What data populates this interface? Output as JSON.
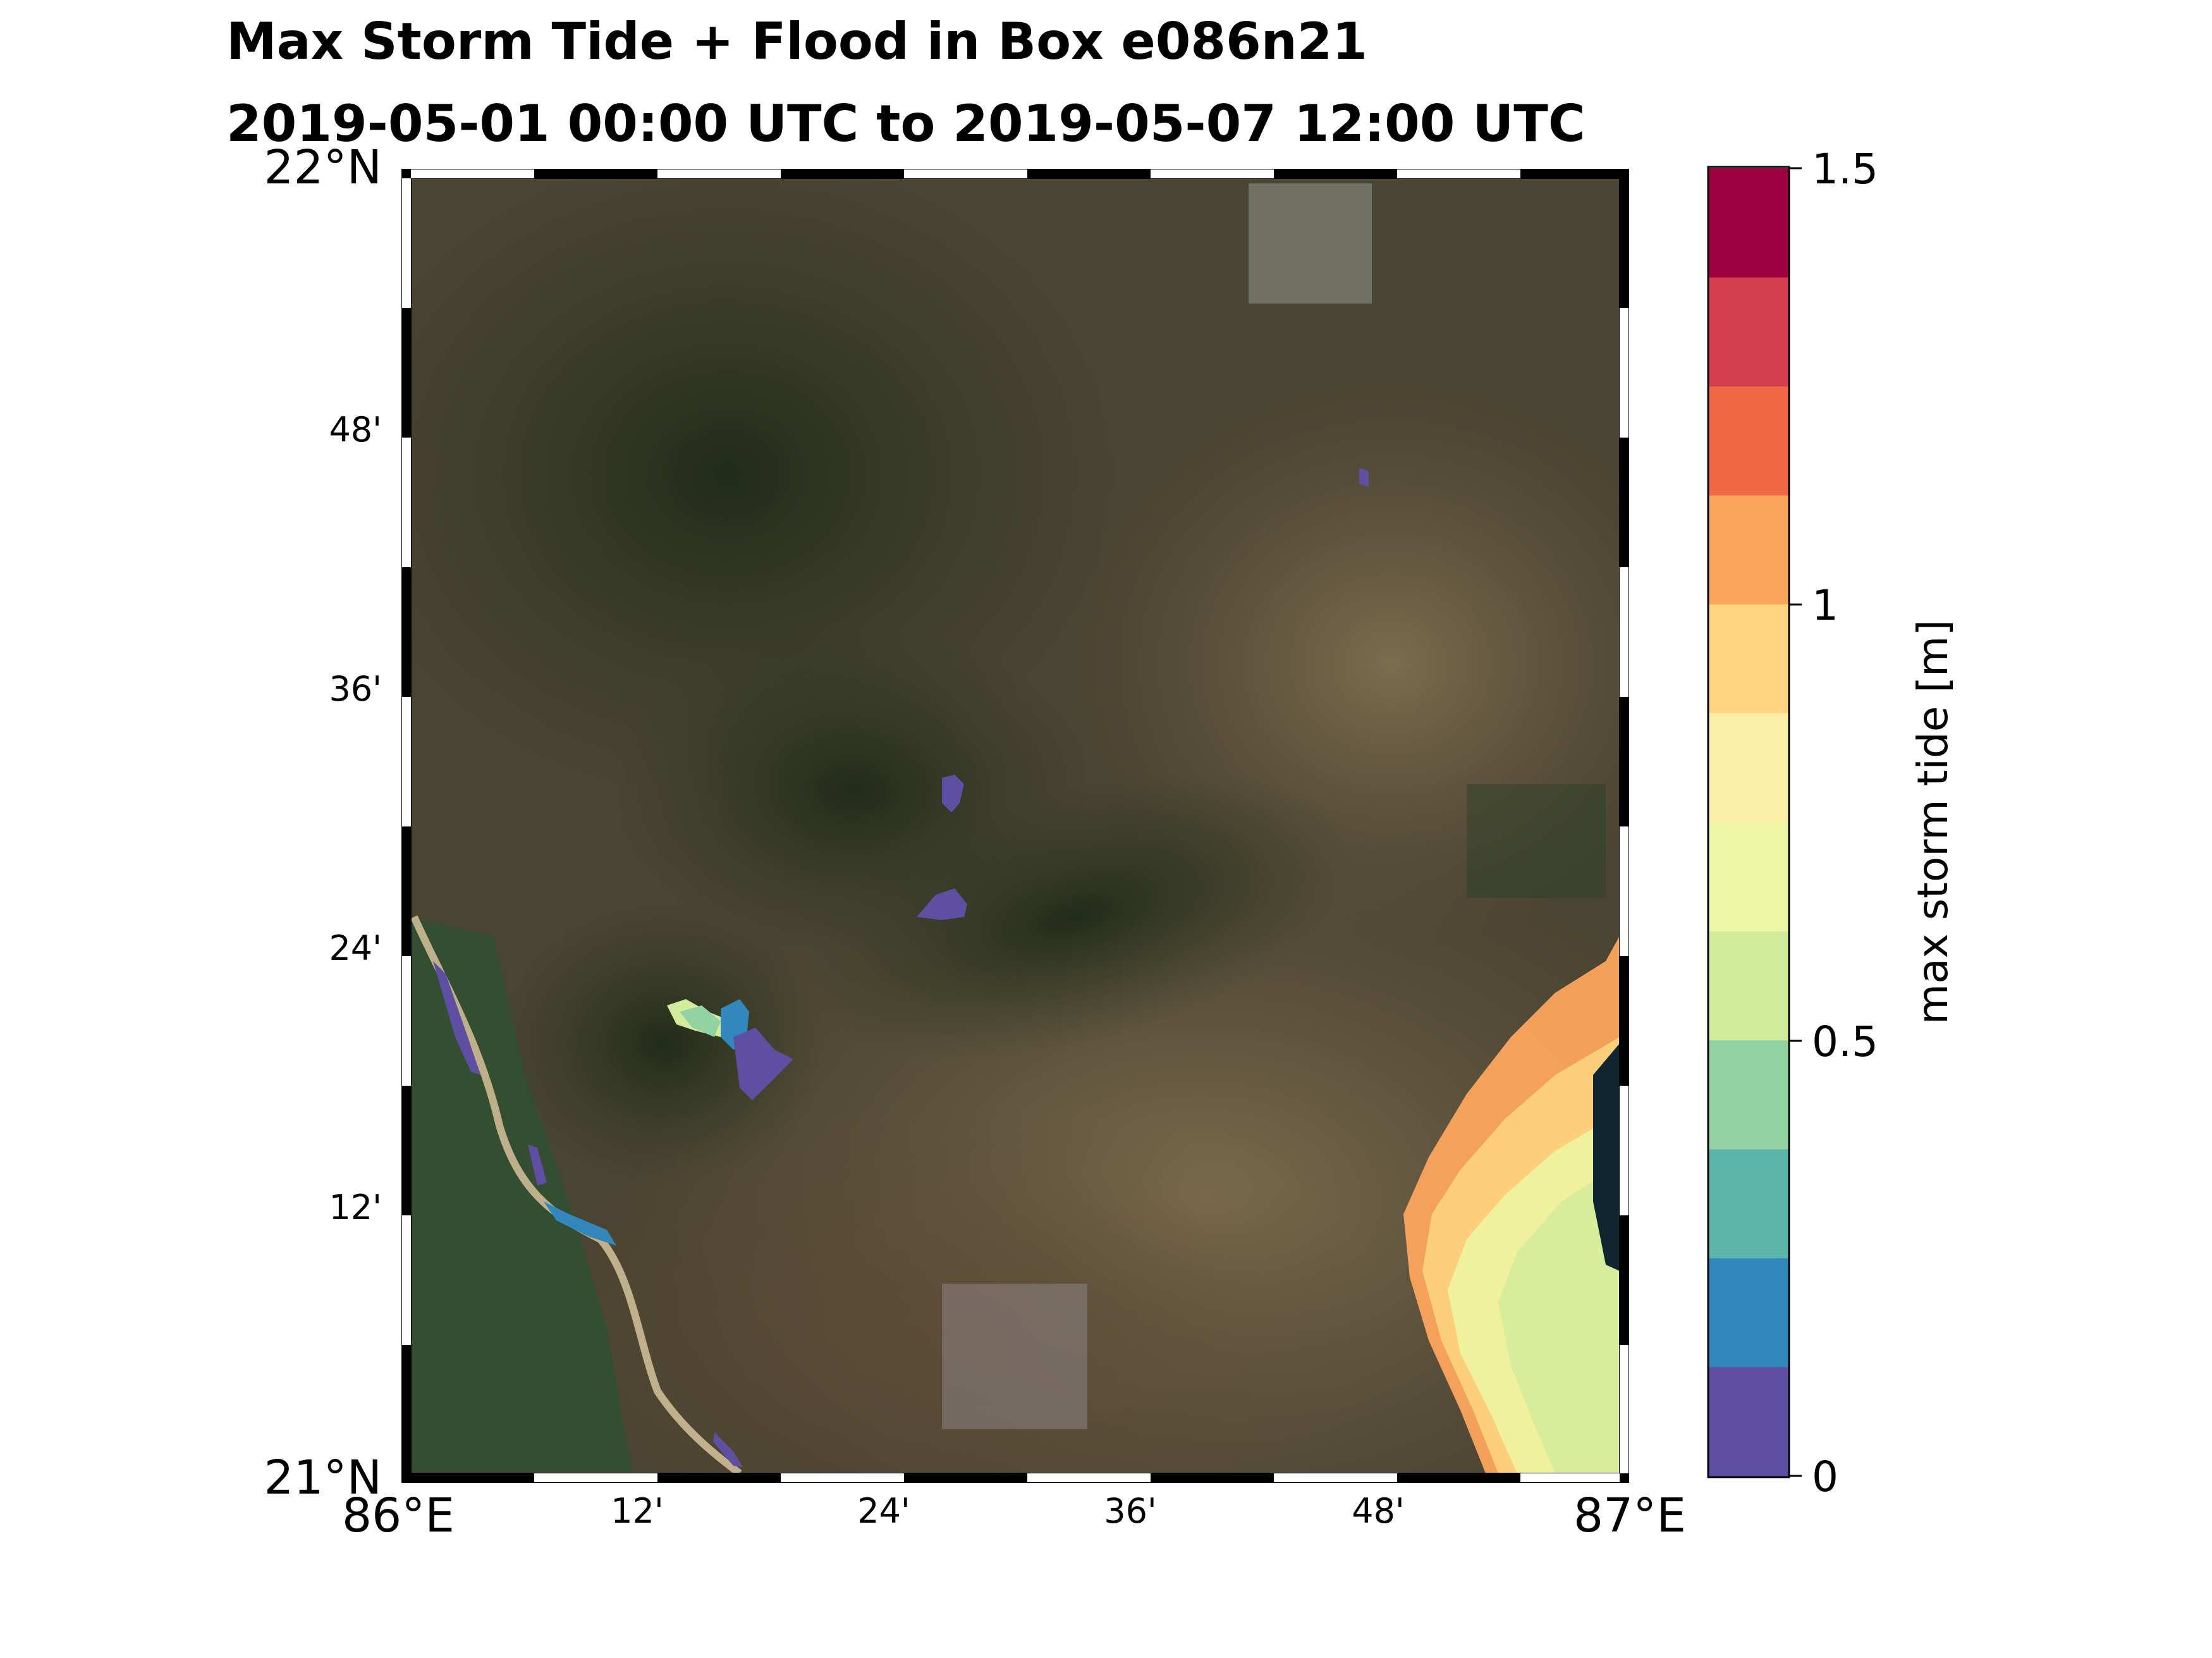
{
  "title": {
    "line1": "Max Storm Tide + Flood in Box e086n21",
    "line2": "2019-05-01 00:00 UTC to 2019-05-07 12:00 UTC"
  },
  "axes": {
    "lat_labels": [
      "22°N",
      "48'",
      "36'",
      "24'",
      "12'",
      "21°N"
    ],
    "lon_labels": [
      "86°E",
      "12'",
      "24'",
      "36'",
      "48'",
      "87°E"
    ]
  },
  "colorbar": {
    "label": "max storm tide [m]",
    "tick_labels": [
      "1.5",
      "1",
      "0.5",
      "0"
    ],
    "colors": [
      "#5e4fa2",
      "#3288bd",
      "#5bb6a9",
      "#93d3a2",
      "#d1ec9c",
      "#edf7a3",
      "#fbeea7",
      "#fed480",
      "#fca55d",
      "#f06944",
      "#d53e4f",
      "#9e0142"
    ]
  },
  "chart_data": {
    "type": "heatmap",
    "variable": "max storm tide",
    "units": "m",
    "extent": {
      "lon": [
        86.0,
        87.0
      ],
      "lat": [
        21.0,
        22.0
      ]
    },
    "clim": [
      0,
      1.5
    ],
    "levels": [
      0,
      0.125,
      0.25,
      0.375,
      0.5,
      0.625,
      0.75,
      0.875,
      1.0,
      1.125,
      1.25,
      1.375,
      1.5
    ],
    "basemap": "satellite imagery",
    "features": [
      {
        "region": "inland flood patches near 86.2-86.3°E, 21.35-21.4°N",
        "max_storm_tide_m": [
          0.1,
          0.5
        ]
      },
      {
        "region": "inland flood patches near 86.4°E, 21.45-21.55°N",
        "max_storm_tide_m": [
          0.0,
          0.1
        ]
      },
      {
        "region": "river channel along western edge",
        "max_storm_tide_m": [
          0.0,
          0.25
        ]
      },
      {
        "region": "coastal area, southeast corner",
        "max_storm_tide_m": [
          0.6,
          1.15
        ]
      }
    ]
  }
}
